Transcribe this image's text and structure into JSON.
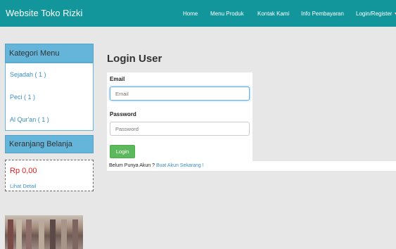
{
  "navbar": {
    "brand": "Website Toko Rizki",
    "links": [
      "Home",
      "Menu Produk",
      "Kontak Kami",
      "Info Pembayaran",
      "Login/Register"
    ]
  },
  "sidebar": {
    "category_title": "Kategori Menu",
    "categories": [
      "Sejadah ( 1 )",
      "Peci ( 1 )",
      "Al Qur'an ( 1 )"
    ],
    "cart_title": "Keranjang Belanja",
    "cart_total": "Rp 0,00",
    "cart_detail_link": "Lihat Detail"
  },
  "main": {
    "title": "Login User",
    "email_label": "Email",
    "email_placeholder": "Email",
    "password_label": "Password",
    "password_placeholder": "Password",
    "login_button": "Login",
    "register_prompt": "Belum Punya Akun ? ",
    "register_link": "Buat Akun Sekarang !"
  },
  "colors": {
    "navbar": "#12969b",
    "panel_header": "#64b5d9",
    "login_button": "#5cb85c",
    "cart_total": "#e0201f",
    "link": "#3a8fc0"
  }
}
